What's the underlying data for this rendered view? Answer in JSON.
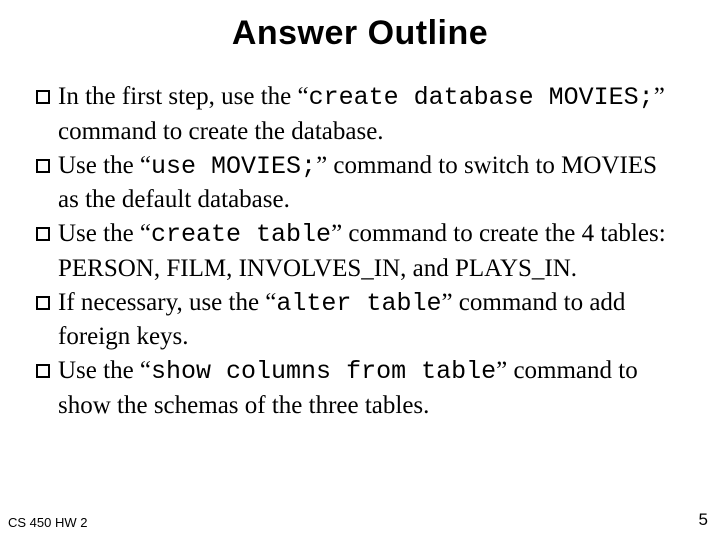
{
  "title": "Answer Outline",
  "items": [
    {
      "pre": "In the first step, use the “",
      "code": "create database MOVIES;",
      "post": "” command to create the database."
    },
    {
      "pre": "Use the “",
      "code": "use MOVIES;",
      "post": "” command to switch to MOVIES as the default database."
    },
    {
      "pre": "Use the “",
      "code": "create table",
      "post": "” command to create the 4 tables: PERSON, FILM, INVOLVES_IN, and PLAYS_IN."
    },
    {
      "pre": "If necessary, use the “",
      "code": "alter table",
      "post": "” command to add foreign keys."
    },
    {
      "pre": "Use the “",
      "code": "show columns from table",
      "post": "” command to show the schemas of the three tables."
    }
  ],
  "footer": {
    "left": "CS 450 HW 2",
    "right": "5"
  }
}
